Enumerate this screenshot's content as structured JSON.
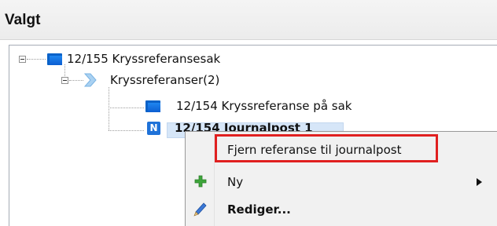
{
  "header": {
    "title": "Valgt"
  },
  "tree": {
    "root": {
      "label": "12/155 Kryssreferansesak",
      "icon": "folder-icon"
    },
    "group": {
      "label": "Kryssreferanser(2)",
      "icon": "chevron-right-icon"
    },
    "children": [
      {
        "label": "12/154 Kryssreferanse på sak",
        "icon": "folder-icon"
      },
      {
        "label": "12/154 Journalpost 1",
        "icon": "n-badge-icon",
        "badge": "N",
        "selected": true
      }
    ]
  },
  "context_menu": {
    "items": [
      {
        "label": "Fjern referanse til journalpost",
        "highlighted": true
      },
      {
        "label": "Ny",
        "icon": "plus-icon",
        "has_submenu": true
      },
      {
        "label": "Rediger...",
        "icon": "pencil-icon",
        "bold": true
      }
    ]
  },
  "colors": {
    "folder": "#0a62c8",
    "selection": "#d6e6f8",
    "highlight_border": "#e02020",
    "badge": "#1f72d8"
  }
}
